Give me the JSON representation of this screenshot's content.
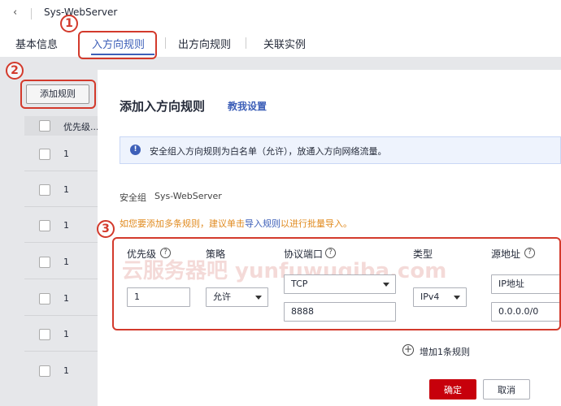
{
  "header": {
    "title": "Sys-WebServer",
    "tabs": [
      {
        "label": "基本信息"
      },
      {
        "label": "入方向规则"
      },
      {
        "label": "出方向规则"
      },
      {
        "label": "关联实例"
      }
    ]
  },
  "background": {
    "add_rule_label": "添加规则",
    "table_header_priority": "优先级...",
    "row_values": [
      "1",
      "1",
      "1",
      "1",
      "1",
      "1",
      "1"
    ]
  },
  "dialog": {
    "title": "添加入方向规则",
    "help_link": "教我设置",
    "info_text": "安全组入方向规则为白名单（允许），放通入方向网络流量。",
    "security_group_label": "安全组",
    "security_group_value": "Sys-WebServer",
    "hint_prefix": "如您要添加多条规则，建议单击",
    "hint_link": "导入规则",
    "hint_suffix": "以进行批量导入。",
    "columns": {
      "priority": "优先级",
      "policy": "策略",
      "protocol_port": "协议端口",
      "type": "类型",
      "source": "源地址"
    },
    "row": {
      "priority": "1",
      "policy": "允许",
      "protocol": "TCP",
      "port": "8888",
      "type": "IPv4",
      "source_type": "IP地址",
      "source_value": "0.0.0.0/0"
    },
    "add_one_rule": "增加1条规则",
    "ok_label": "确定",
    "cancel_label": "取消"
  },
  "annotations": {
    "step1": "1",
    "step2": "2",
    "step3": "3"
  },
  "watermark": "云服务器吧 yunfuwuqiba.com",
  "colors": {
    "accent_blue": "#3d5fb8",
    "primary_red": "#c7000b",
    "annotation_red": "#d33a2c",
    "hint_orange": "#e08a1e"
  }
}
